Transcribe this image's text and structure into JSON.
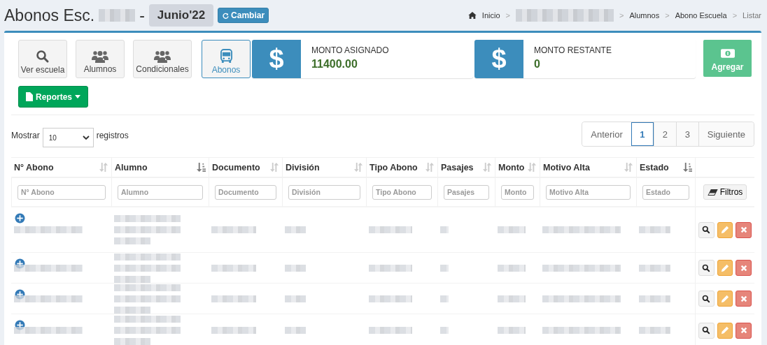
{
  "header": {
    "title_prefix": "Abonos Esc.",
    "title_redacted": true,
    "title_suffix": "-",
    "period": "Junio'22",
    "change_button": "Cambiar"
  },
  "breadcrumb": [
    {
      "kind": "home",
      "label": "Inicio"
    },
    {
      "kind": "redacted"
    },
    {
      "kind": "link",
      "label": "Alumnos"
    },
    {
      "kind": "link",
      "label": "Abono Escuela"
    },
    {
      "kind": "current",
      "label": "Listar"
    }
  ],
  "breadcrumb_separator": ">",
  "toolbar": [
    {
      "label": "Ver escuela",
      "selected": false
    },
    {
      "label": "Alumnos",
      "selected": false
    },
    {
      "label": "Condicionales",
      "selected": false
    },
    {
      "label": "Abonos",
      "selected": true
    }
  ],
  "info_boxes": [
    {
      "icon_text": "$",
      "label": "MONTO ASIGNADO",
      "value": "11400.00"
    },
    {
      "icon_text": "$",
      "label": "MONTO RESTANTE",
      "value": "0"
    }
  ],
  "add_button": "Agregar",
  "reports_button": "Reportes",
  "length_menu": {
    "before": "Mostrar",
    "value": "10",
    "after": "registros"
  },
  "pagination": {
    "previous": "Anterior",
    "next": "Siguiente",
    "pages": [
      {
        "label": "1",
        "selected": true
      },
      {
        "label": "2",
        "selected": false
      },
      {
        "label": "3",
        "selected": false
      }
    ]
  },
  "table": {
    "columns": [
      {
        "label": "N° Abono",
        "sorted": false,
        "placeholder": "N° Abono"
      },
      {
        "label": "Alumno",
        "sorted": true,
        "placeholder": "Alumno"
      },
      {
        "label": "Documento",
        "sorted": false,
        "placeholder": "Documento"
      },
      {
        "label": "División",
        "sorted": false,
        "placeholder": "División"
      },
      {
        "label": "Tipo Abono",
        "sorted": false,
        "placeholder": "Tipo Abono"
      },
      {
        "label": "Pasajes",
        "sorted": false,
        "placeholder": "Pasajes"
      },
      {
        "label": "Monto",
        "sorted": false,
        "placeholder": "Monto"
      },
      {
        "label": "Motivo Alta",
        "sorted": false,
        "placeholder": "Motivo Alta"
      },
      {
        "label": "Estado",
        "sorted": true,
        "placeholder": "Estado"
      }
    ],
    "filters_button": "Filtros",
    "rows": [
      {
        "kind": "redacted",
        "expanded": false
      },
      {
        "kind": "redacted",
        "expanded": false
      },
      {
        "kind": "redacted",
        "expanded": false
      },
      {
        "kind": "redacted",
        "expanded": false
      }
    ]
  }
}
